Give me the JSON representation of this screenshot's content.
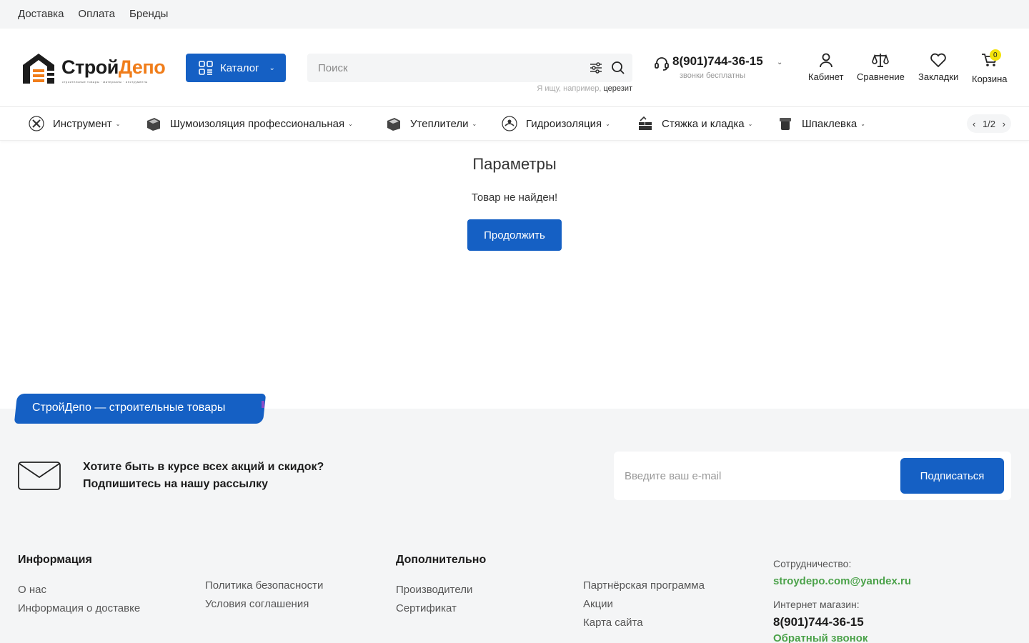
{
  "topbar": {
    "links": [
      "Доставка",
      "Оплата",
      "Бренды"
    ]
  },
  "header": {
    "logo": {
      "word_a": "Строй",
      "word_b": "Депо",
      "tagline": "строительные товары · материалы · инструменты"
    },
    "catalog_label": "Каталог",
    "search": {
      "placeholder": "Поиск",
      "hint_prefix": "Я ищу, например,",
      "hint_example": "церезит"
    },
    "phone": {
      "number": "8(901)744-36-15",
      "note": "звонки бесплатны"
    },
    "icons": {
      "cabinet": "Кабинет",
      "compare": "Сравнение",
      "bookmarks": "Закладки",
      "cart": "Корзина",
      "cart_count": "0"
    }
  },
  "nav": {
    "items": [
      {
        "label": "Инструмент",
        "icon": "tools-icon"
      },
      {
        "label": "Шумоизоляция профессиональная",
        "icon": "soundproofing-icon"
      },
      {
        "label": "Утеплители",
        "icon": "insulation-icon"
      },
      {
        "label": "Гидроизоляция",
        "icon": "waterproofing-icon"
      },
      {
        "label": "Стяжка и кладка",
        "icon": "screed-icon"
      },
      {
        "label": "Шпаклевка",
        "icon": "putty-icon"
      }
    ],
    "pager": "1/2"
  },
  "main": {
    "title": "Параметры",
    "message": "Товар не найден!",
    "button": "Продолжить"
  },
  "footer": {
    "banner": "СтройДепо — строительные товары",
    "subscribe": {
      "line1": "Хотите быть в курсе всех акций и скидок?",
      "line2": "Подпишитесь на нашу рассылку",
      "placeholder": "Введите ваш e-mail",
      "button": "Подписаться"
    },
    "info": {
      "title": "Информация",
      "col1": [
        "О нас",
        "Информация о доставке"
      ],
      "col2": [
        "Политика безопасности",
        "Условия соглашения"
      ]
    },
    "extra": {
      "title": "Дополнительно",
      "col1": [
        "Производители",
        "Сертификат"
      ],
      "col2": [
        "Партнёрская программа",
        "Акции",
        "Карта сайта"
      ]
    },
    "contacts": {
      "coop_label": "Сотрудничество:",
      "email": "stroydepo.com@yandex.ru",
      "shop_label": "Интернет магазин:",
      "phone": "8(901)744-36-15",
      "callback": "Обратный звонок"
    }
  },
  "colors": {
    "primary": "#1560c4",
    "accent_orange": "#f07d1a",
    "green": "#4ba24a",
    "badge": "#f4e30a"
  }
}
